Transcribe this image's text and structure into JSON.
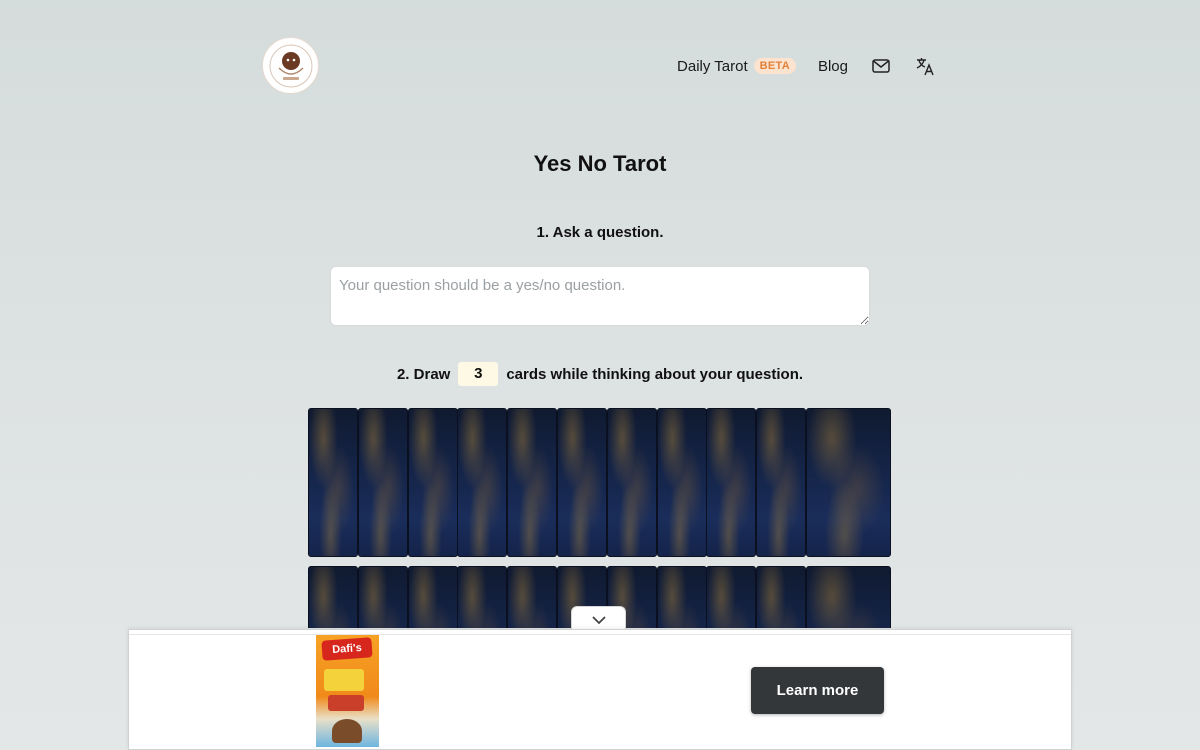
{
  "header": {
    "nav": {
      "daily_tarot": "Daily Tarot",
      "beta_badge": "BETA",
      "blog": "Blog"
    },
    "icons": [
      "logo",
      "mail-icon",
      "language-icon"
    ]
  },
  "main": {
    "title": "Yes No Tarot",
    "step1": "1. Ask a question.",
    "question_placeholder": "Your question should be a yes/no question.",
    "step2_prefix": "2. Draw",
    "card_count": "3",
    "step2_suffix": "cards while thinking about your question."
  },
  "ad": {
    "button_label": "Learn more",
    "product_brand": "Dafi's"
  },
  "colors": {
    "beta_text": "#e0823a",
    "beta_bg": "#fbe3cf",
    "card_back": "#15254a",
    "ad_button": "#34373a"
  }
}
